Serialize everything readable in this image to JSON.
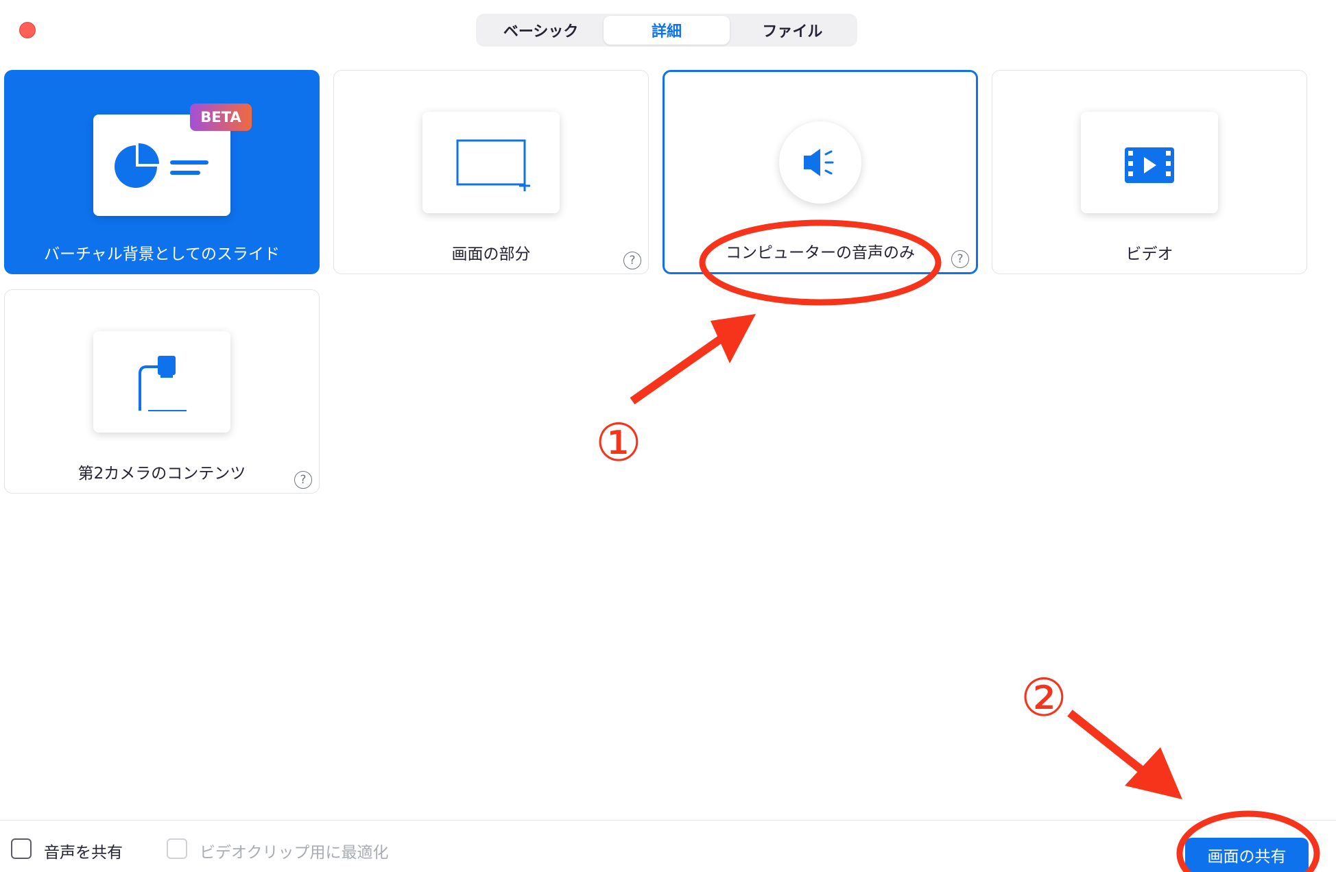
{
  "window": {
    "close_color": "#fe5f57"
  },
  "tabs": [
    {
      "label": "ベーシック",
      "active": false
    },
    {
      "label": "詳細",
      "active": true
    },
    {
      "label": "ファイル",
      "active": false
    }
  ],
  "cards": [
    {
      "label": "バーチャル背景としてのスライド",
      "badge": "BETA",
      "icon": "slides-icon",
      "state": "highlighted"
    },
    {
      "label": "画面の部分",
      "icon": "screen-portion-icon",
      "help": "?"
    },
    {
      "label": "コンピューターの音声のみ",
      "icon": "speaker-icon",
      "help": "?",
      "state": "selected"
    },
    {
      "label": "ビデオ",
      "icon": "video-film-icon"
    },
    {
      "label": "第2カメラのコンテンツ",
      "icon": "document-camera-icon",
      "help": "?"
    }
  ],
  "footer": {
    "share_audio_label": "音声を共有",
    "optimize_video_label": "ビデオクリップ用に最適化",
    "share_button_label": "画面の共有"
  },
  "annotations": {
    "marker_1": "①",
    "marker_2": "②",
    "color": "#f5341b"
  },
  "colors": {
    "accent": "#0e72ed"
  }
}
